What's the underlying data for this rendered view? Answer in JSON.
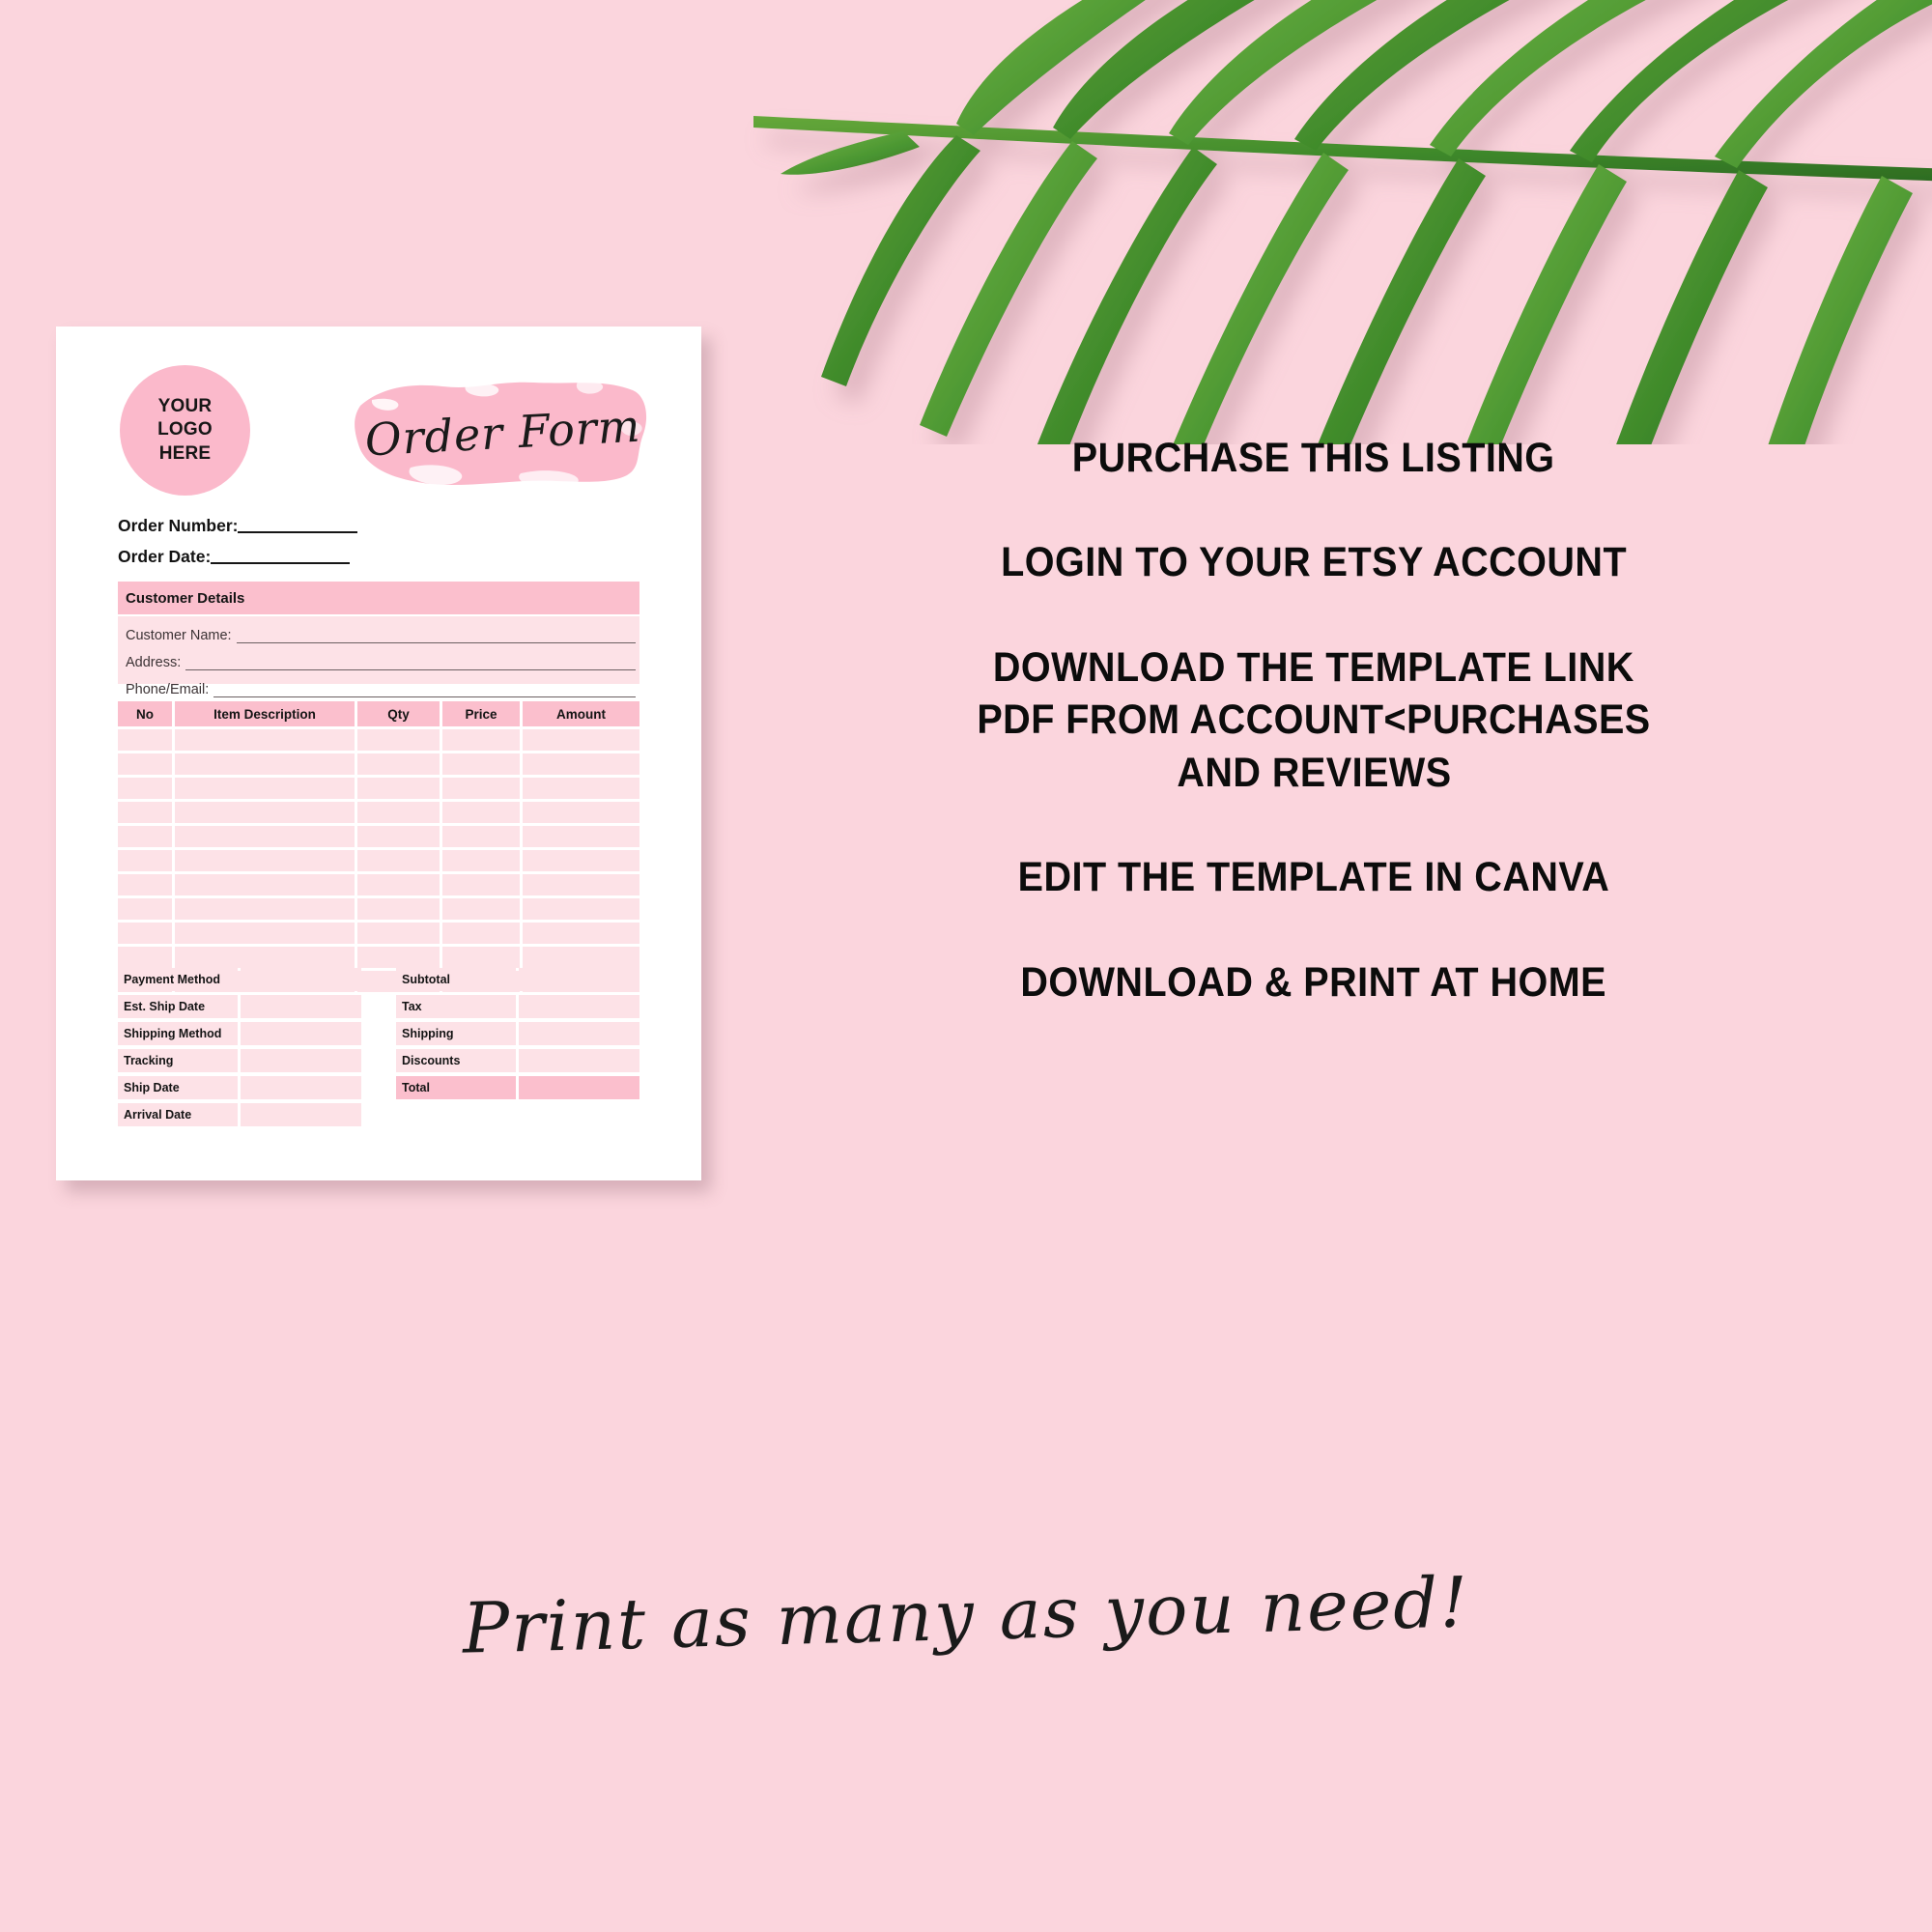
{
  "background": {
    "color": "#fbd5dd",
    "decoration": "palm-leaf-top-right"
  },
  "order_form": {
    "logo_placeholder": {
      "line1": "YOUR",
      "line2": "LOGO",
      "line3": "HERE"
    },
    "title": "Order Form",
    "order_number_label": "Order Number:",
    "order_date_label": "Order Date:",
    "customer_details": {
      "heading": "Customer Details",
      "fields": [
        "Customer Name:",
        "Address:",
        "Phone/Email:"
      ]
    },
    "items_table": {
      "columns": [
        "No",
        "Item Description",
        "Qty",
        "Price",
        "Amount"
      ],
      "empty_row_count": 11
    },
    "shipping_summary": [
      "Payment Method",
      "Est. Ship Date",
      "Shipping Method",
      "Tracking",
      "Ship Date",
      "Arrival Date"
    ],
    "totals_summary": [
      "Subtotal",
      "Tax",
      "Shipping",
      "Discounts",
      "Total"
    ],
    "colors": {
      "header_pink": "#fbbfcd",
      "row_pink": "#fde2e7",
      "paper": "#ffffff"
    }
  },
  "promo": {
    "lines": [
      "PURCHASE THIS LISTING",
      "LOGIN TO YOUR ETSY ACCOUNT",
      "DOWNLOAD THE TEMPLATE LINK",
      "PDF FROM ACCOUNT<PURCHASES",
      "AND REVIEWS",
      "EDIT THE TEMPLATE IN CANVA",
      "DOWNLOAD & PRINT AT HOME"
    ]
  },
  "footer": {
    "tagline": "Print as many as you need!"
  }
}
